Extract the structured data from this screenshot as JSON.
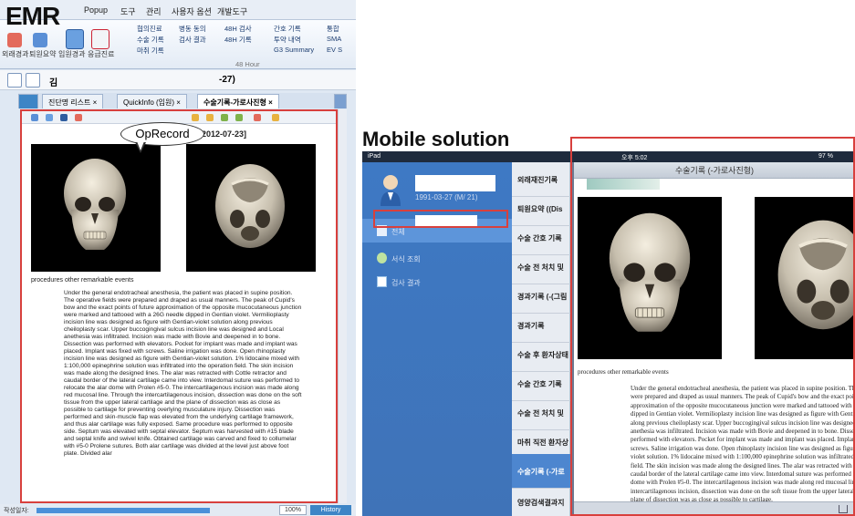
{
  "labels": {
    "emr": "EMR",
    "mobile": "Mobile solution",
    "callout": "OpRecord"
  },
  "emr": {
    "menu": [
      "Popup",
      "도구",
      "관리",
      "사용자 옵션",
      "개발도구"
    ],
    "ribbon": {
      "big_buttons": [
        "외래경과",
        "퇴원요약",
        "입원경과",
        "응급진료"
      ],
      "rows_col1": [
        "협의진료",
        "수술 기록",
        "마취 기록"
      ],
      "rows_col2": [
        "병동 동의",
        "검사 결과",
        ""
      ],
      "rows_col3": [
        "48H 검사",
        "48H 기록",
        ""
      ],
      "rows_col4": [
        "간호 기록",
        "투약 내역",
        "G3 Summary"
      ],
      "rows_col5": [
        "통합",
        "SMA",
        "EV S"
      ],
      "group_label": "48 Hour"
    },
    "info": {
      "name": "김",
      "age": "-27)"
    },
    "tabs": [
      "진단명 리스트",
      "QuickInfo (입원)",
      "수술기록-가로사진형"
    ],
    "date": "[2012-07-23]",
    "caption": "procedures    other remarkable events",
    "op_text": "Under the general endotracheal anesthesia, the patient was placed in supine position. The operative fields were prepared and draped as usual manners. The peak of Cupid's bow and the exact points of future approximation of the opposite mucocutaneous junction were marked and tattooed with a 26G needle dipped in Gentian violet. Vermilioplasty incision line was designed as figure with Gentian-violet solution along previous cheiloplasty scar. Upper buccogingival sulcus incision line was designed and Local anethesia was infiltrated. Incision was made with Bovie and deepened in to bone. Dissection was performed with elevators. Pocket for implant was made and implant was placed. Implant was fixed with screws. Saline irrigation was done. Open rhinoplasty incision line was designed as figure with Gentian-violet solution. 1% lidocaine mixed with 1:100,000 epinephrine solution was infiltrated into the operation field. The skin incision was made along the designed lines. The alar was retracted with Cottle retractor and caudal border of the lateral cartilage came into view. Interdomal suture was performed to relocate the alar dome with Prolen #5-0. The intercartilagenous incision was made along red mucosal line. Through the intercartilagenous incision, dissection was done on the soft tissue from the upper lateral cartilage and the plane of dissection was as close as possible to cartilage for preventing overlying musculature injury. Dissection was performed and skin-muscle flap was elevated from the underlying cartilage framework, and thus alar cartilage was fully exposed. Same procedure was performed to opposite side. Septum was elevated with septal elevator. Septum was harvested with #15 blade and septal knife and swivel knife. Obtained cartilage was carved and fixed to collumelar with #5-0 Prolene sutures. Both alar cartilage was divided at the level just above foot plate. Divided alar",
    "status": {
      "label": "작성일자:",
      "zoom": "100%",
      "history": "History"
    }
  },
  "ipad": {
    "status": {
      "left": "iPad",
      "time": "오후 5:02",
      "battery": "97 %"
    },
    "patient_dob": "1991-03-27 (M/ 21)",
    "side_items": [
      "전체",
      "서식 조회",
      "검사 결과"
    ],
    "list_items": [
      "외래재진기록",
      "퇴원요약 ((Dis",
      "수술 간호 기록",
      "수술 전 처치 및",
      "경과기록 (-(그림",
      "경과기록",
      "수술 후 환자상태",
      "수술 간호 기록",
      "수술 전 처치 및",
      "마취 직전 환자상",
      "수술기록 (-가로",
      "영양검색결과지"
    ],
    "header": "수술기록 (-가로사진형)",
    "caption": "procedures    other remarkable events",
    "op_text": "Under the general endotracheal anesthesia, the patient was placed in supine position. The operative fields were prepared and draped as usual manners. The peak of Cupid's bow and the exact points of future approximation of the opposite mucocutaneous junction were marked and tattooed with a 26G needle dipped in Gentian violet. Vermilioplasty incision line was designed as figure with Gentian-violet solution along previous cheiloplasty scar. Upper buccogingival sulcus incision line was designed and Local anethesia was infiltrated. Incision was made with Bovie and deepened in to bone. Dissection was performed with elevators. Pocket for implant was made and implant was placed. Implant was fixed with screws. Saline irrigation was done. Open rhinoplasty incision line was designed as figure with Gentian-violet solution. 1% lidocaine mixed with 1:100,000 epinephrine solution was infiltrated into the operation field. The skin incision was made along the designed lines. The alar was retracted with Cottle retractor and caudal border of the lateral cartilage came into view. Interdomal suture was performed to relocate the alar dome with Prolen #5-0. The intercartilagenous incision was made along red mucosal line. Through the intercartilagenous incision, dissection was done on the soft tissue from the upper lateral cartilage and the plane of dissection was as close as possible to cartilage."
  },
  "colors": {
    "highlight": "#d8403d",
    "ipad_sidebar": "#3e79c4",
    "emr_accent": "#3d85c6"
  }
}
